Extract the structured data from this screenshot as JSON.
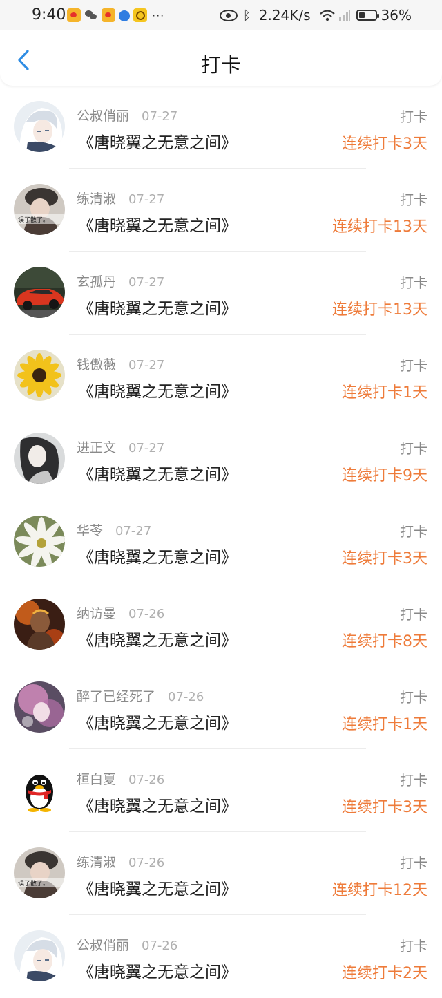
{
  "status_bar": {
    "time": "9:40",
    "network_speed": "2.24K/s",
    "battery": "36%",
    "battery_level": 0.36,
    "more": "···",
    "app_icons": [
      "weibo-icon",
      "wechat-icon",
      "weibo-icon",
      "browser-icon",
      "app-icon"
    ]
  },
  "header": {
    "title": "打卡",
    "back_icon": "chevron-left-icon",
    "accent_color": "#2f8de4"
  },
  "colors": {
    "streak": "#ee7b3a",
    "name": "#8a8a8a",
    "date": "#b0b0b0"
  },
  "checkins": [
    {
      "name": "公叔俏丽",
      "date": "07-27",
      "tag": "打卡",
      "book": "《唐晓翼之无意之间》",
      "streak": "连续打卡3天",
      "avatar": "anime-white-hair"
    },
    {
      "name": "练清淑",
      "date": "07-27",
      "tag": "打卡",
      "book": "《唐晓翼之无意之间》",
      "streak": "连续打卡13天",
      "avatar": "girl-hat",
      "avatar_caption": "误了散了。"
    },
    {
      "name": "玄孤丹",
      "date": "07-27",
      "tag": "打卡",
      "book": "《唐晓翼之无意之间》",
      "streak": "连续打卡13天",
      "avatar": "red-car"
    },
    {
      "name": "钱傲薇",
      "date": "07-27",
      "tag": "打卡",
      "book": "《唐晓翼之无意之间》",
      "streak": "连续打卡1天",
      "avatar": "sunflower"
    },
    {
      "name": "进正文",
      "date": "07-27",
      "tag": "打卡",
      "book": "《唐晓翼之无意之间》",
      "streak": "连续打卡9天",
      "avatar": "girl-grey"
    },
    {
      "name": "华苓",
      "date": "07-27",
      "tag": "打卡",
      "book": "《唐晓翼之无意之间》",
      "streak": "连续打卡3天",
      "avatar": "daisy"
    },
    {
      "name": "纳访曼",
      "date": "07-26",
      "tag": "打卡",
      "book": "《唐晓翼之无意之间》",
      "streak": "连续打卡8天",
      "avatar": "game-hero"
    },
    {
      "name": "醉了已经死了",
      "date": "07-26",
      "tag": "打卡",
      "book": "《唐晓翼之无意之间》",
      "streak": "连续打卡1天",
      "avatar": "pink-anime"
    },
    {
      "name": "桓白夏",
      "date": "07-26",
      "tag": "打卡",
      "book": "《唐晓翼之无意之间》",
      "streak": "连续打卡3天",
      "avatar": "qq-penguin"
    },
    {
      "name": "练清淑",
      "date": "07-26",
      "tag": "打卡",
      "book": "《唐晓翼之无意之间》",
      "streak": "连续打卡12天",
      "avatar": "girl-hat",
      "avatar_caption": "误了散了。"
    },
    {
      "name": "公叔俏丽",
      "date": "07-26",
      "tag": "打卡",
      "book": "《唐晓翼之无意之间》",
      "streak": "连续打卡2天",
      "avatar": "anime-white-hair"
    }
  ]
}
